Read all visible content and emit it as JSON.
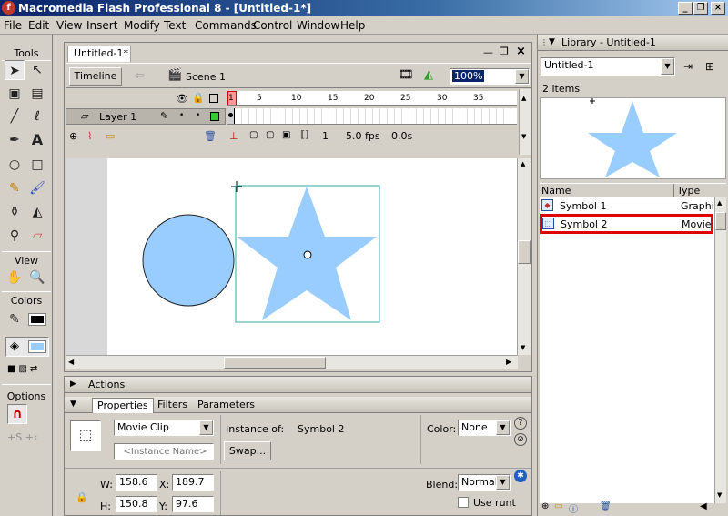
{
  "window": {
    "title": "Macromedia Flash Professional 8 - [Untitled-1*]",
    "app_icon": "f"
  },
  "menu": [
    "File",
    "Edit",
    "View",
    "Insert",
    "Modify",
    "Text",
    "Commands",
    "Control",
    "Window",
    "Help"
  ],
  "tools": {
    "header": "Tools",
    "view_label": "View",
    "colors_label": "Colors",
    "options_label": "Options",
    "stroke_color": "#000000",
    "fill_color": "#99ccff"
  },
  "document": {
    "tab": "Untitled-1*",
    "timeline_button": "Timeline",
    "scene": "Scene 1",
    "zoom": "100%",
    "layer_name": "Layer 1",
    "frame_numbers": [
      "1",
      "5",
      "10",
      "15",
      "20",
      "25",
      "30",
      "35"
    ],
    "current_frame": "1",
    "fps": "5.0 fps",
    "time": "0.0s"
  },
  "stage": {
    "fill_color": "#99ccff"
  },
  "actions": {
    "label": "Actions"
  },
  "properties": {
    "tabs": [
      "Properties",
      "Filters",
      "Parameters"
    ],
    "symbol_behavior": "Movie Clip",
    "instance_name_placeholder": "<Instance Name>",
    "instance_of_label": "Instance of:",
    "instance_of_value": "Symbol 2",
    "swap_label": "Swap...",
    "color_label": "Color:",
    "color_value": "None",
    "w_label": "W:",
    "w_value": "158.6",
    "h_label": "H:",
    "h_value": "150.8",
    "x_label": "X:",
    "x_value": "189.7",
    "y_label": "Y:",
    "y_value": "97.6",
    "blend_label": "Blend:",
    "blend_value": "Normal",
    "use_runtime_label": "Use runt"
  },
  "library": {
    "title": "Library - Untitled-1",
    "document": "Untitled-1",
    "items_count": "2 items",
    "columns": {
      "name": "Name",
      "type": "Type"
    },
    "items": [
      {
        "name": "Symbol 1",
        "type": "Graphic"
      },
      {
        "name": "Symbol 2",
        "type": "Movie C"
      }
    ],
    "highlight_color": "#e00000"
  }
}
